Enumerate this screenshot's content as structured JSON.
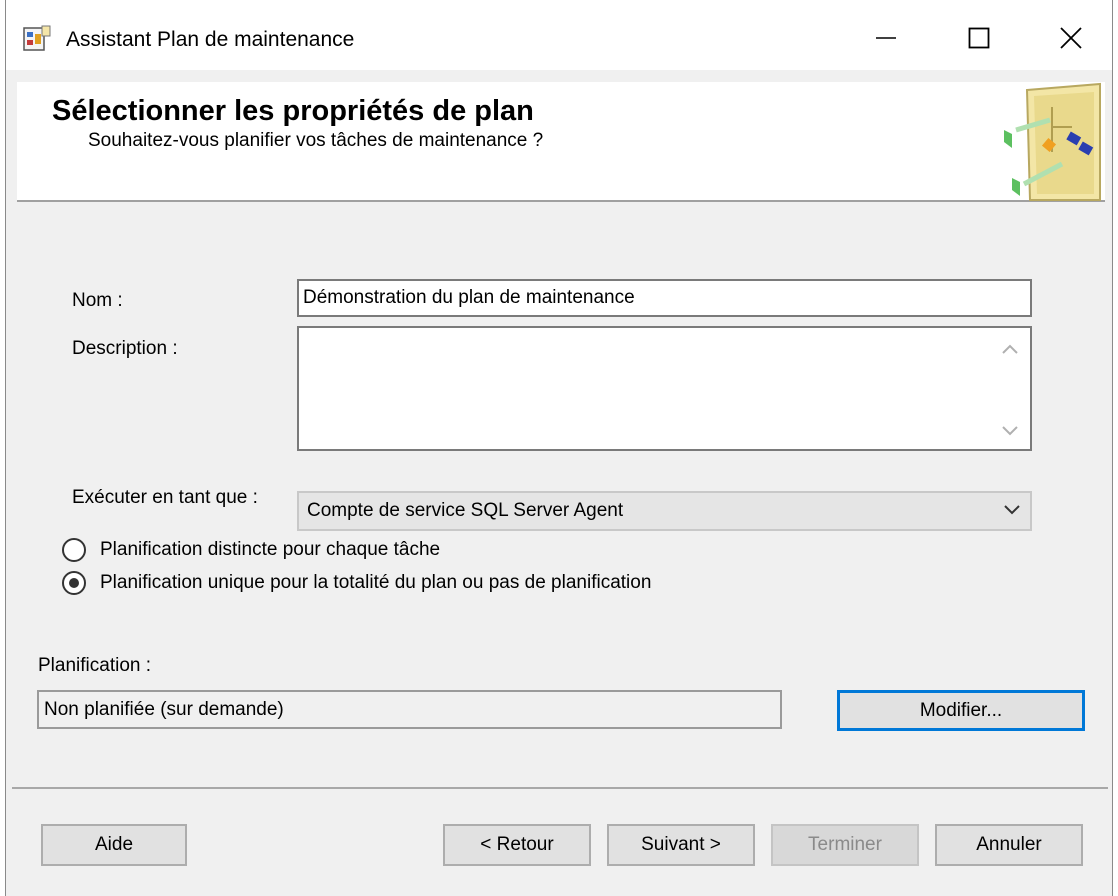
{
  "window": {
    "title": "Assistant Plan de maintenance",
    "icon": "wizard-app-icon",
    "controls": [
      "minimize-icon",
      "maximize-icon",
      "close-icon"
    ]
  },
  "banner": {
    "title": "Sélectionner les propriétés de plan",
    "subtitle": "Souhaitez-vous planifier vos tâches de maintenance ?"
  },
  "form": {
    "name_label": "Nom :",
    "name_value": "Démonstration du plan de maintenance",
    "description_label": "Description :",
    "description_value": "",
    "run_as_label": "Exécuter en tant que :",
    "run_as_value": "Compte de service SQL Server Agent",
    "radio_separate": "Planification distincte pour chaque tâche",
    "radio_single": "Planification unique pour la totalité du plan ou pas de planification",
    "selected_radio": "single"
  },
  "schedule": {
    "label": "Planification :",
    "value": "Non planifiée (sur demande)",
    "change_button": "Modifier..."
  },
  "footer": {
    "help": "Aide",
    "back": "< Retour",
    "next": "Suivant >",
    "finish": "Terminer",
    "cancel": "Annuler"
  },
  "colors": {
    "focus_accent": "#0078d7",
    "dialog_background": "#f0f0f0"
  }
}
